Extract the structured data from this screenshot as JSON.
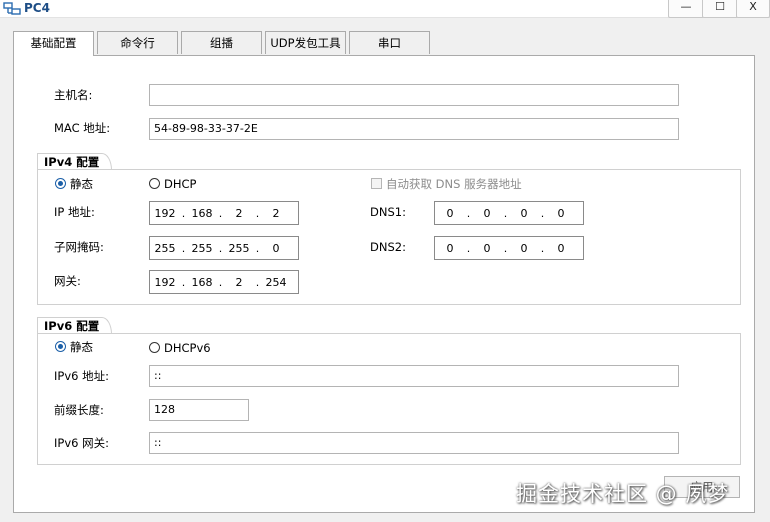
{
  "window": {
    "title": "PC4",
    "minimize": "—",
    "maximize": "☐",
    "close": "X"
  },
  "tabs": [
    {
      "label": "基础配置",
      "active": true
    },
    {
      "label": "命令行"
    },
    {
      "label": "组播"
    },
    {
      "label": "UDP发包工具"
    },
    {
      "label": "串口"
    }
  ],
  "basic": {
    "hostname_label": "主机名:",
    "hostname_value": "",
    "mac_label": "MAC 地址:",
    "mac_value": "54-89-98-33-37-2E"
  },
  "ipv4": {
    "title": "IPv4 配置",
    "static_label": "静态",
    "dhcp_label": "DHCP",
    "auto_dns_label": "自动获取 DNS 服务器地址",
    "ip_label": "IP 地址:",
    "ip": [
      "192",
      "168",
      "2",
      "2"
    ],
    "mask_label": "子网掩码:",
    "mask": [
      "255",
      "255",
      "255",
      "0"
    ],
    "gateway_label": "网关:",
    "gateway": [
      "192",
      "168",
      "2",
      "254"
    ],
    "dns1_label": "DNS1:",
    "dns1": [
      "0",
      "0",
      "0",
      "0"
    ],
    "dns2_label": "DNS2:",
    "dns2": [
      "0",
      "0",
      "0",
      "0"
    ]
  },
  "ipv6": {
    "title": "IPv6 配置",
    "static_label": "静态",
    "dhcp_label": "DHCPv6",
    "ip_label": "IPv6 地址:",
    "ip_value": "::",
    "prefix_label": "前缀长度:",
    "prefix_value": "128",
    "gateway_label": "IPv6 网关:",
    "gateway_value": "::"
  },
  "footer": {
    "apply_label": "应用"
  },
  "watermark": "掘金技术社区 @ 夙梦",
  "colors": {
    "title": "#1e4e86",
    "radio_selected": "#1b5fa8"
  }
}
